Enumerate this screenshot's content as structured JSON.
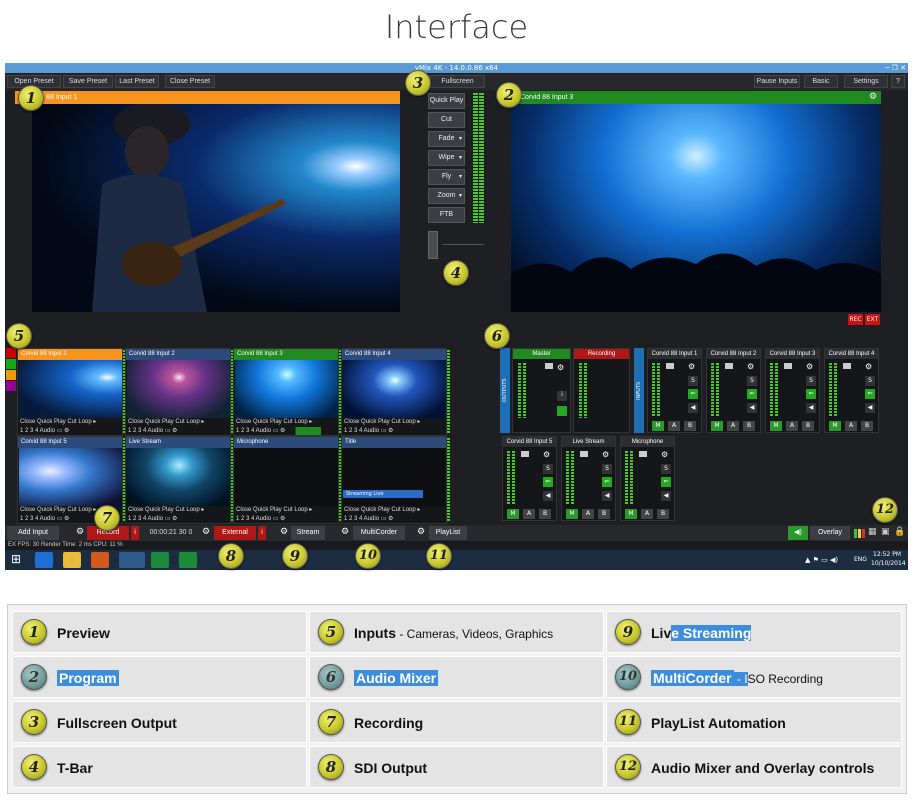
{
  "page": {
    "title": "Interface"
  },
  "window": {
    "titlebar": "vMix 4K - 14.0.0.86 x64",
    "controls": "─ ❐ ✕",
    "toolbar": {
      "open_preset": "Open Preset",
      "save_preset": "Save Preset",
      "last_preset": "Last Preset",
      "close_preset": "Close Preset",
      "fullscreen": "Fullscreen",
      "pause_inputs": "Pause Inputs",
      "basic": "Basic",
      "settings": "Settings",
      "help": "?"
    },
    "preview": {
      "label": "Corvid 88 Input 1",
      "color": "#f7941d"
    },
    "program": {
      "label": "Corvid 88 Input 3",
      "color": "#1f8a1f",
      "rec": "REC",
      "ext": "EXT"
    },
    "transitions": [
      "Quick Play",
      "Cut",
      "Fade",
      "Wipe",
      "Fly",
      "Zoom",
      "FTB"
    ],
    "inputs": [
      {
        "title": "Corvid 88 Input 1",
        "color": "#f7941d",
        "ctrl": "Close  Quick Play  Cut  Loop",
        "nums": "1  2  3  4      Audio"
      },
      {
        "title": "Corvid 88 Input 2",
        "color": "#2c4a7a",
        "ctrl": "Close  Quick Play  Cut  Loop",
        "nums": "1  2  3  4      Audio"
      },
      {
        "title": "Corvid 88 Input 3",
        "color": "#1f8a1f",
        "ctrl": "Close  Quick Play  Cut  Loop",
        "nums": "1  2  3  4      Audio"
      },
      {
        "title": "Corvid 88 Input 4",
        "color": "#2c4a7a",
        "ctrl": "Close  Quick Play  Cut  Loop",
        "nums": "1  2  3  4      Audio"
      },
      {
        "title": "Corvid 88 Input 5",
        "color": "#2c4a7a",
        "ctrl": "Close  Quick Play  Cut  Loop",
        "nums": "1  2  3  4      Audio"
      },
      {
        "title": "Live Stream",
        "color": "#2c4a7a",
        "ctrl": "Close  Quick Play  Cut  Loop",
        "nums": "1  2  3  4      Audio"
      },
      {
        "title": "Microphone",
        "color": "#2c4a7a",
        "ctrl": "Close  Quick Play  Cut  Loop",
        "nums": "1  2  3  4      Audio"
      },
      {
        "title": "Title",
        "color": "#2c4a7a",
        "ctrl": "Close  Quick Play  Cut  Loop",
        "nums": "1  2  3  4      Audio",
        "overlay_text": "Streaming Live"
      }
    ],
    "mixer": {
      "outputs_label": "OUTPUTS",
      "inputs_label": "INPUTS",
      "master": "Master",
      "recording": "Recording",
      "channels": [
        "Corvid 88 Input 1",
        "Corvid 88 Input 2",
        "Corvid 88 Input 3",
        "Corvid 88 Input 4",
        "Corvid 88 Input 5",
        "Live Stream",
        "Microphone"
      ],
      "m": "M",
      "a": "A",
      "b": "B",
      "s": "S"
    },
    "bottom": {
      "add_input": "Add Input",
      "record": "Record",
      "record_time": "00:00:21 30 0",
      "external": "External",
      "stream": "Stream",
      "multicorder": "MultiCorder",
      "playlist": "PlayList",
      "overlay": "Overlay"
    },
    "status": {
      "text": "EX  FPS: 30  Render Time: 2 ms  CPU: 11 %"
    },
    "taskbar": {
      "time": "12:52 PM",
      "date": "10/10/2014",
      "lang": "ENG"
    }
  },
  "legend": [
    {
      "n": "1",
      "label": "Preview",
      "sub": ""
    },
    {
      "n": "5",
      "label": "Inputs",
      "sub": " - Cameras, Videos, Graphics"
    },
    {
      "n": "9",
      "label": "Live Streaming",
      "sub": ""
    },
    {
      "n": "2",
      "label": "Program",
      "sub": ""
    },
    {
      "n": "6",
      "label": "Audio Mixer",
      "sub": ""
    },
    {
      "n": "10",
      "label": "MultiCorder",
      "sub": " - ISO Recording"
    },
    {
      "n": "3",
      "label": "Fullscreen Output",
      "sub": ""
    },
    {
      "n": "7",
      "label": "Recording",
      "sub": ""
    },
    {
      "n": "11",
      "label": "PlayList Automation",
      "sub": ""
    },
    {
      "n": "4",
      "label": "T-Bar",
      "sub": ""
    },
    {
      "n": "8",
      "label": "SDI Output",
      "sub": ""
    },
    {
      "n": "12",
      "label": "Audio Mixer and Overlay controls",
      "sub": ""
    }
  ],
  "badges": [
    "1",
    "2",
    "3",
    "4",
    "5",
    "6",
    "7",
    "8",
    "9",
    "10",
    "11",
    "12"
  ]
}
